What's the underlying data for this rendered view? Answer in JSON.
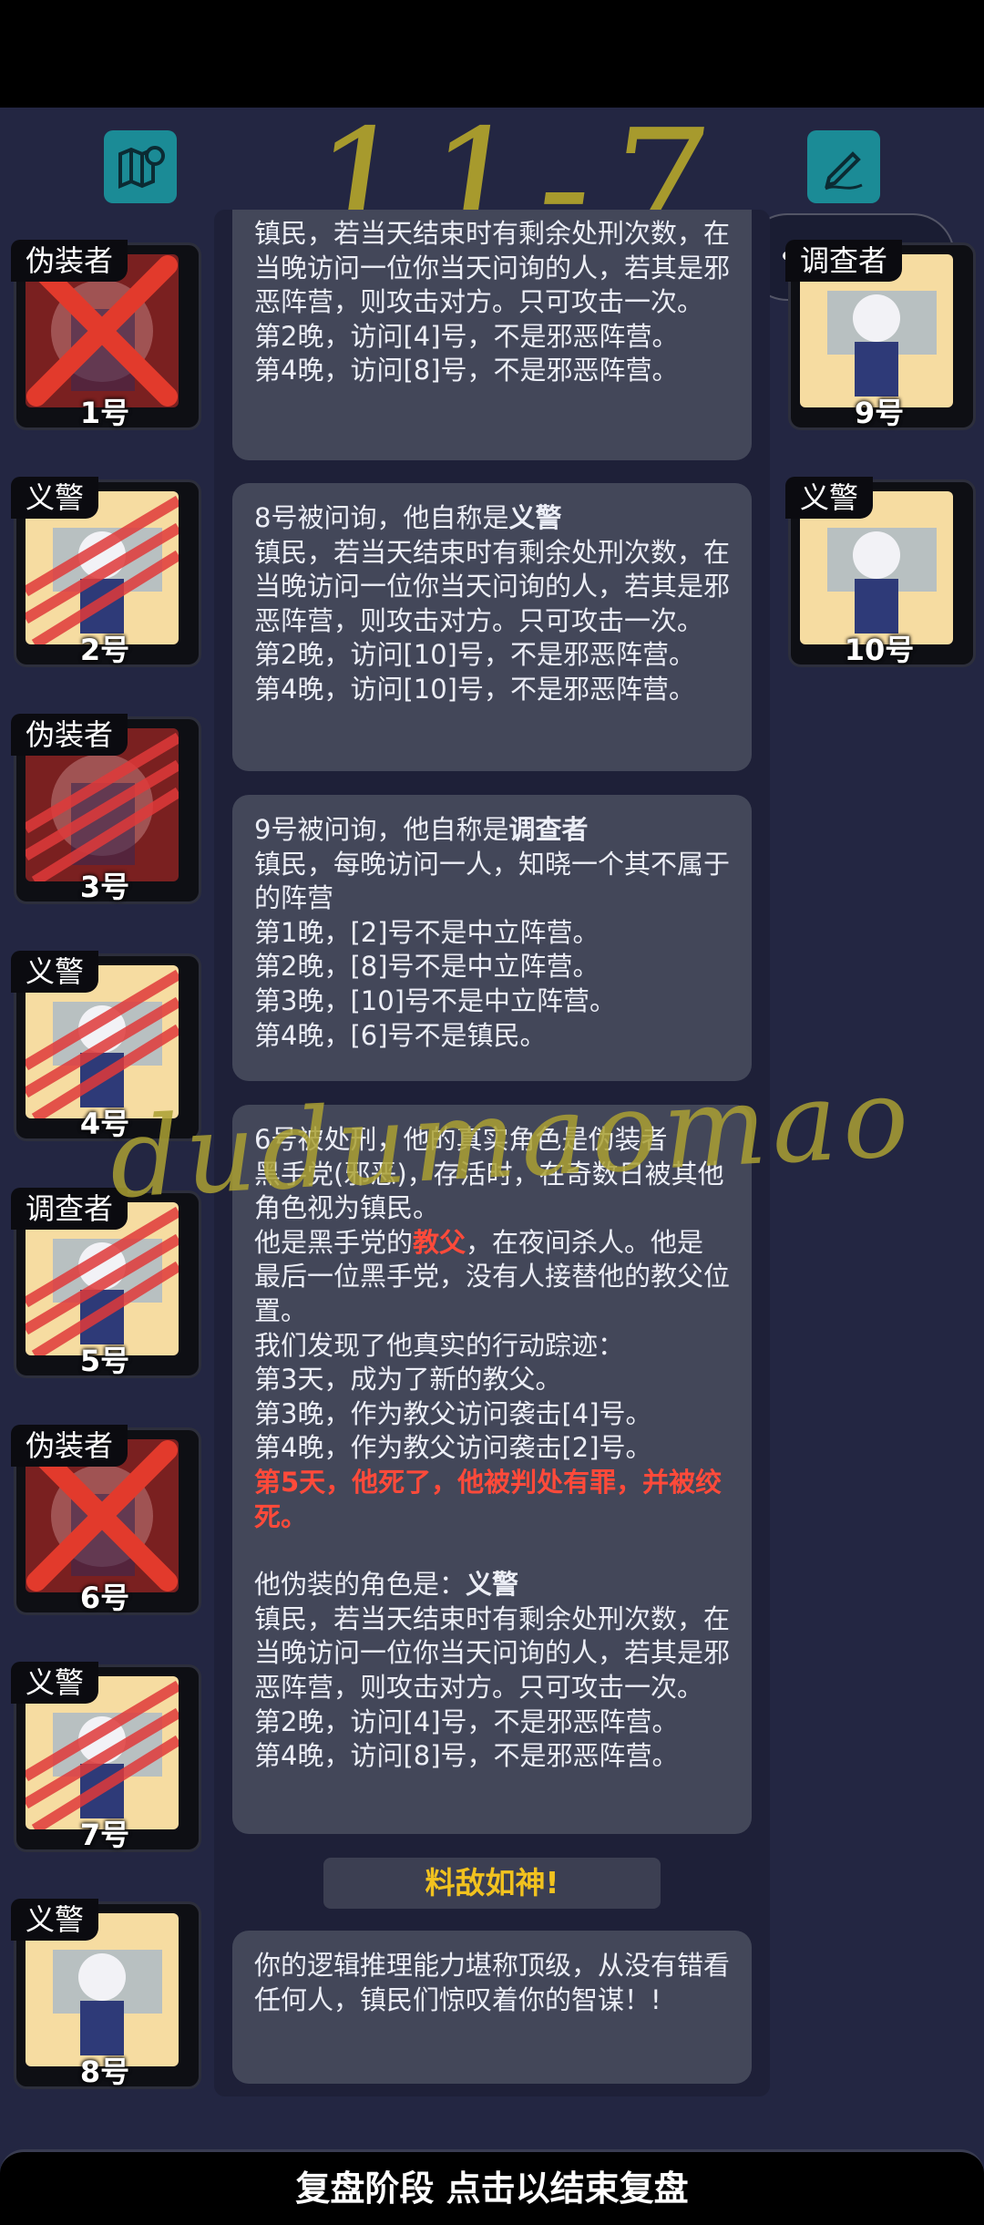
{
  "watermark": "11-7",
  "capsule": {
    "dots": "•••",
    "target": "◎"
  },
  "players_left": [
    {
      "role": "伪装者",
      "number": "1号",
      "art": "evil",
      "marked": "x"
    },
    {
      "role": "义警",
      "number": "2号",
      "art": "town",
      "marked": "scratch"
    },
    {
      "role": "伪装者",
      "number": "3号",
      "art": "evil",
      "marked": "scratch"
    },
    {
      "role": "义警",
      "number": "4号",
      "art": "town",
      "marked": "scratch"
    },
    {
      "role": "调查者",
      "number": "5号",
      "art": "town",
      "marked": "scratch"
    },
    {
      "role": "伪装者",
      "number": "6号",
      "art": "evil",
      "marked": "x"
    },
    {
      "role": "义警",
      "number": "7号",
      "art": "town",
      "marked": "scratch"
    },
    {
      "role": "义警",
      "number": "8号",
      "art": "town",
      "marked": "none"
    }
  ],
  "players_right": [
    {
      "role": "调查者",
      "number": "9号",
      "art": "town",
      "marked": "none"
    },
    {
      "role": "义警",
      "number": "10号",
      "art": "town",
      "marked": "none"
    }
  ],
  "cards": {
    "c1": {
      "lines": [
        "镇民，若当天结束时有剩余处刑次数，在当晚访问一位你当天问询的人，若其是邪恶阵营，则攻击对方。只可攻击一次。",
        "第2晚，访问[4]号，不是邪恶阵营。",
        "第4晚，访问[8]号，不是邪恶阵营。"
      ]
    },
    "c2": {
      "intro": "8号被问询，他自称是",
      "claim": "义警",
      "lines": [
        "镇民，若当天结束时有剩余处刑次数，在当晚访问一位你当天问询的人，若其是邪恶阵营，则攻击对方。只可攻击一次。",
        "第2晚，访问[10]号，不是邪恶阵营。",
        "第4晚，访问[10]号，不是邪恶阵营。"
      ]
    },
    "c3": {
      "intro": "9号被问询，他自称是",
      "claim": "调查者",
      "lines": [
        "镇民，每晚访问一人，知晓一个其不属于的阵营",
        "第1晚，[2]号不是中立阵营。",
        "第2晚，[8]号不是中立阵营。",
        "第3晚，[10]号不是中立阵营。",
        "第4晚，[6]号不是镇民。"
      ]
    },
    "c4": {
      "l1": "6号被处刑，他的真实角色是伪装者",
      "l2": "黑手党(邪恶)，存活时，在奇数日被其他角色视为镇民。",
      "l3a": "他是黑手党的",
      "l3b": "教父",
      "l3c": "，在夜间杀人。他是最后一位黑手党，没有人接替他的教父位置。",
      "l4": "我们发现了他真实的行动踪迹：",
      "l5": "第3天，成为了新的教父。",
      "l6": "第3晚，作为教父访问袭击[4]号。",
      "l7": "第4晚，作为教父访问袭击[2]号。",
      "death": "第5天，他死了，他被判处有罪，并被绞死。",
      "fake_intro": "他伪装的角色是：",
      "fake_role": "义警",
      "fake_desc": "镇民，若当天结束时有剩余处刑次数，在当晚访问一位你当天问询的人，若其是邪恶阵营，则攻击对方。只可攻击一次。",
      "f1": "第2晚，访问[4]号，不是邪恶阵营。",
      "f2": "第4晚，访问[8]号，不是邪恶阵营。"
    },
    "bonus": "料敌如神!",
    "final": "你的逻辑推理能力堪称顶级，从没有错看任何人，镇民们惊叹着你的智谋！!"
  },
  "bottom_bar": "复盘阶段 点击以结束复盘",
  "signature": "dudumaomao",
  "icons": {
    "map": "map-icon",
    "note": "pencil-note-icon"
  }
}
